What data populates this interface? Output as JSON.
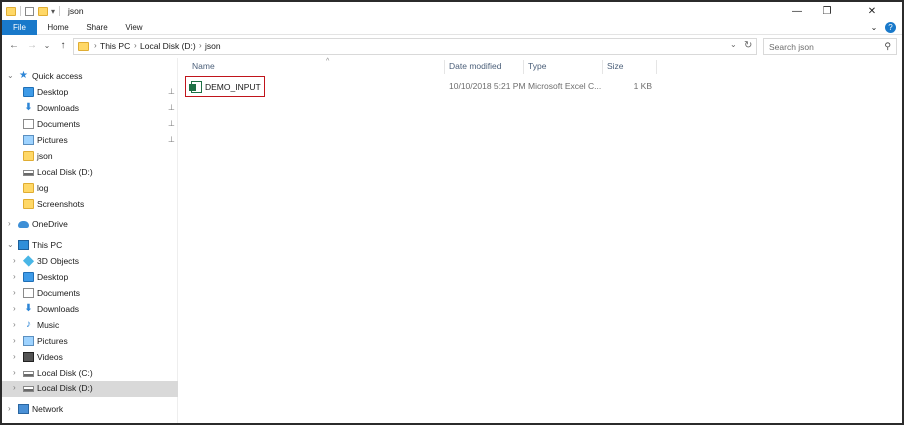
{
  "window": {
    "title": "json",
    "controls": {
      "minimize": "—",
      "maximize": "❐",
      "close": "✕"
    }
  },
  "ribbon": {
    "tabs": [
      "File",
      "Home",
      "Share",
      "View"
    ],
    "collapse_glyph": "⌄",
    "help_glyph": "?"
  },
  "address": {
    "back": "←",
    "forward": "→",
    "recent": "⌄",
    "up": "↑",
    "parts": [
      "This PC",
      "Local Disk (D:)",
      "json"
    ],
    "separator": "›",
    "dropdown": "⌄",
    "refresh": "↻"
  },
  "search": {
    "placeholder": "Search json",
    "icon": "⚲"
  },
  "navpane": {
    "quick_access": {
      "label": "Quick access",
      "items": [
        {
          "label": "Desktop",
          "icon": "desktop-folder-icon",
          "pinned": true
        },
        {
          "label": "Downloads",
          "icon": "downloads-icon",
          "pinned": true
        },
        {
          "label": "Documents",
          "icon": "documents-icon",
          "pinned": true
        },
        {
          "label": "Pictures",
          "icon": "pictures-icon",
          "pinned": true
        },
        {
          "label": "json",
          "icon": "folder-icon",
          "pinned": false
        },
        {
          "label": "Local Disk (D:)",
          "icon": "drive-icon",
          "pinned": false
        },
        {
          "label": "log",
          "icon": "folder-icon",
          "pinned": false
        },
        {
          "label": "Screenshots",
          "icon": "folder-icon",
          "pinned": false
        }
      ]
    },
    "onedrive": {
      "label": "OneDrive"
    },
    "this_pc": {
      "label": "This PC",
      "items": [
        {
          "label": "3D Objects"
        },
        {
          "label": "Desktop"
        },
        {
          "label": "Documents"
        },
        {
          "label": "Downloads"
        },
        {
          "label": "Music"
        },
        {
          "label": "Pictures"
        },
        {
          "label": "Videos"
        },
        {
          "label": "Local Disk (C:)"
        },
        {
          "label": "Local Disk (D:)"
        }
      ]
    },
    "network": {
      "label": "Network"
    },
    "selected": "Local Disk (D:)",
    "pin_glyph": "⊥"
  },
  "filelist": {
    "columns": [
      "Name",
      "Date modified",
      "Type",
      "Size"
    ],
    "sort_glyph": "^",
    "rows": [
      {
        "name": "DEMO_INPUT",
        "date_modified": "10/10/2018 5:21 PM",
        "type": "Microsoft Excel C...",
        "size": "1 KB"
      }
    ]
  },
  "colors": {
    "accent": "#1979ca",
    "highlight_border": "#c0141b",
    "selection": "#d9d9d9"
  }
}
